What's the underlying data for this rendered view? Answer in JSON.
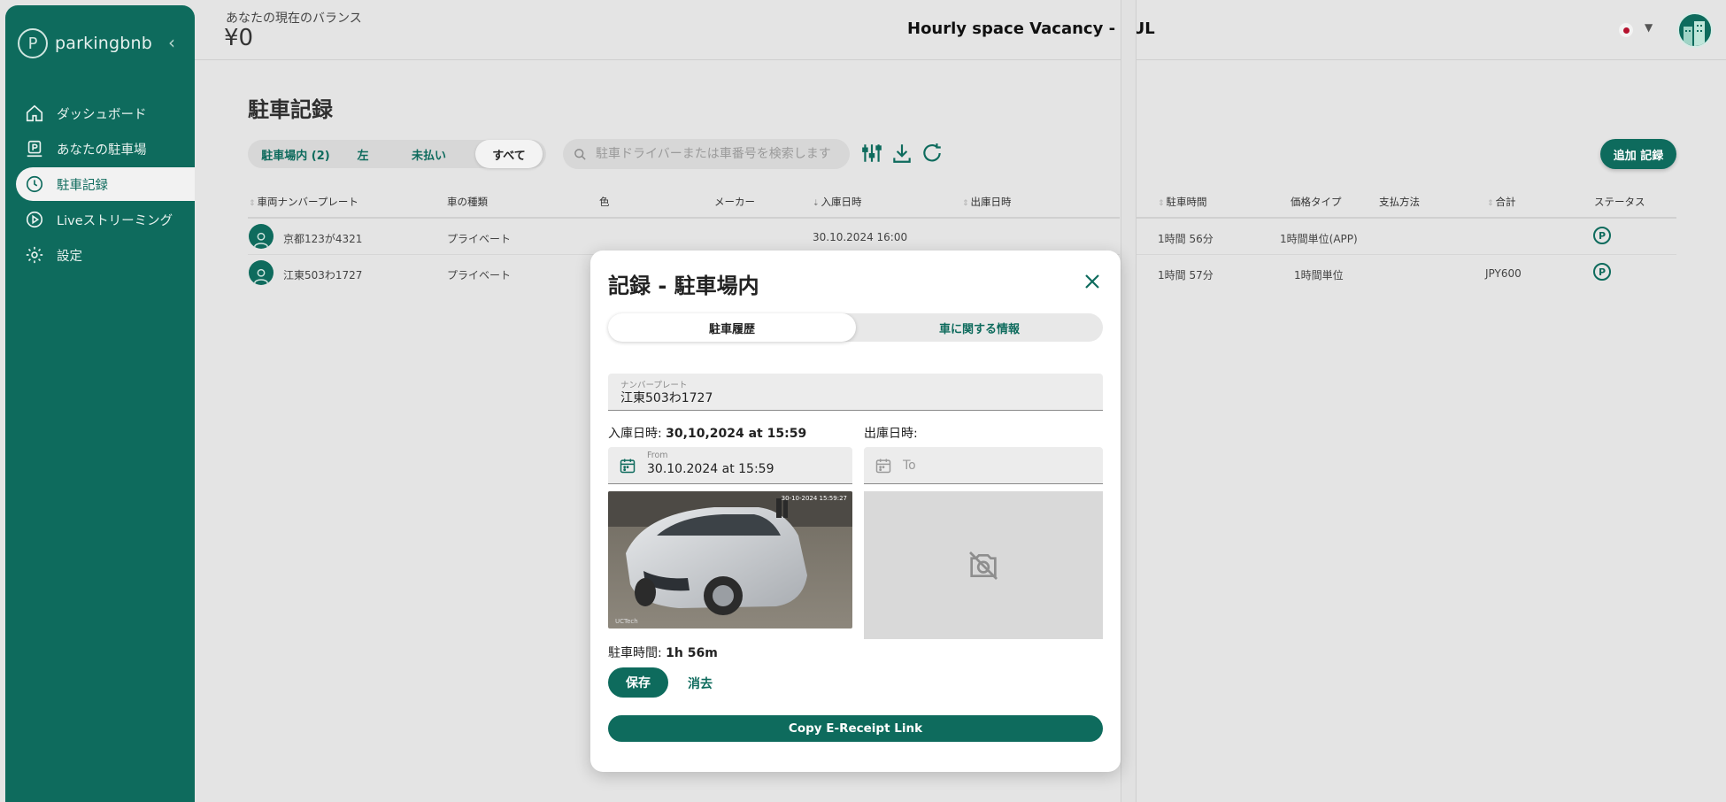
{
  "sidebar": {
    "logo_text": "parkingbnb",
    "collapse_glyph": "‹",
    "items": [
      {
        "label": "ダッシュボード",
        "icon": "home-icon"
      },
      {
        "label": "あなたの駐車場",
        "icon": "parking-lot-icon"
      },
      {
        "label": "駐車記録",
        "icon": "history-icon",
        "active": true
      },
      {
        "label": "Liveストリーミング",
        "icon": "play-icon"
      },
      {
        "label": "設定",
        "icon": "gear-icon"
      }
    ]
  },
  "header": {
    "balance_label": "あなたの現在のバランス",
    "balance_value": "¥0",
    "vacancy_text": "Hourly space Vacancy -  FUL",
    "language_flag": "japan-flag"
  },
  "page": {
    "title": "駐車記録",
    "filter_tabs": [
      "駐車場内 (2)",
      "左",
      "未払い",
      "すべて"
    ],
    "active_filter": "すべて",
    "search_placeholder": "駐車ドライバーまたは車番号を検索します",
    "add_record_label": "追加 記録"
  },
  "table": {
    "headers": [
      "車両ナンバープレート",
      "車の種類",
      "色",
      "メーカー",
      "入庫日時",
      "出庫日時",
      "駐車時間",
      "価格タイプ",
      "支払方法",
      "合計",
      "ステータス"
    ],
    "rows": [
      {
        "plate": "京都123が4321",
        "type": "プライベート",
        "color": "",
        "maker": "",
        "entry": "30.10.2024 16:00",
        "exit": "",
        "duration": "1時間 56分",
        "price_type": "1時間単位(APP)",
        "payment": "",
        "total": "",
        "status": "P"
      },
      {
        "plate": "江東503わ1727",
        "type": "プライベート",
        "color": "",
        "maker": "",
        "entry": "",
        "exit": "",
        "duration": "1時間 57分",
        "price_type": "1時間単位",
        "payment": "",
        "total": "JPY600",
        "status": "P"
      }
    ]
  },
  "modal": {
    "title": "記録 - 駐車場内",
    "tabs": [
      "駐車履歴",
      "車に関する情報"
    ],
    "plate_label": "ナンバープレート",
    "plate_value": "江東503わ1727",
    "entry_label": "入庫日時:",
    "entry_value": "30,10,2024 at 15:59",
    "exit_label": "出庫日時:",
    "from_label": "From",
    "from_value": "30.10.2024 at 15:59",
    "to_placeholder": "To",
    "photo_timestamp": "30-10-2024 15:59:27",
    "photo_watermark": "UCTech",
    "duration_label": "駐車時間:",
    "duration_value": "1h 56m",
    "save_label": "保存",
    "clear_label": "消去",
    "receipt_label": "Copy E-Receipt Link"
  },
  "colors": {
    "brand": "#0e6b5d",
    "background": "#e4e4e4",
    "modal": "#ffffff"
  }
}
